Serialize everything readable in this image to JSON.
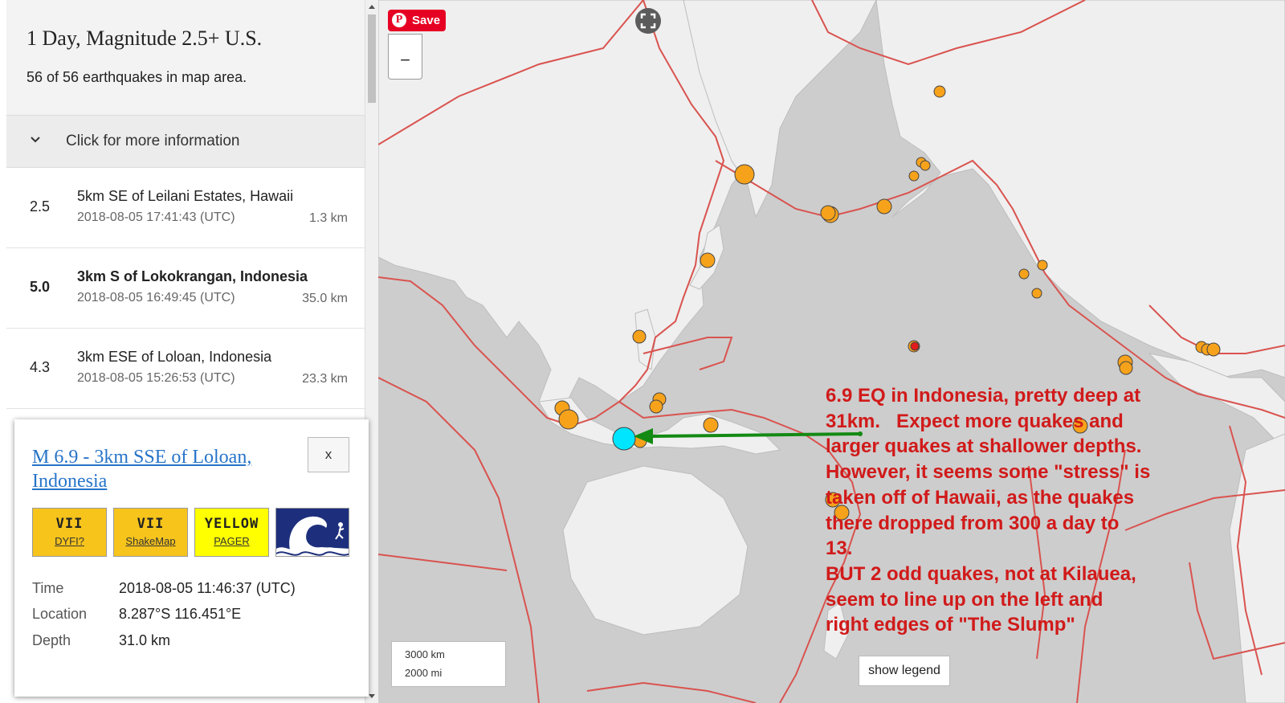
{
  "sidebar": {
    "title": "1 Day, Magnitude 2.5+ U.S.",
    "count_text": "56 of 56 earthquakes in map area.",
    "more_info_label": "Click for more information",
    "earthquakes": [
      {
        "mag": "2.5",
        "place": "5km SE of Leilani Estates, Hawaii",
        "time": "2018-08-05 17:41:43 (UTC)",
        "depth": "1.3 km"
      },
      {
        "mag": "5.0",
        "place": "3km S of Lokokrangan, Indonesia",
        "time": "2018-08-05 16:49:45 (UTC)",
        "depth": "35.0 km"
      },
      {
        "mag": "4.3",
        "place": "3km ESE of Loloan, Indonesia",
        "time": "2018-08-05 15:26:53 (UTC)",
        "depth": "23.3 km"
      }
    ]
  },
  "popup": {
    "title": "M 6.9 - 3km SSE of Loloan, Indonesia",
    "close_label": "x",
    "badges": {
      "dyfi": {
        "value": "VII",
        "label": "DYFI?",
        "color": "#f7c41c"
      },
      "shakemap": {
        "value": "VII",
        "label": "ShakeMap",
        "color": "#f7c41c"
      },
      "pager": {
        "value": "YELLOW",
        "label": "PAGER",
        "color": "#ffff00"
      },
      "tsunami": {
        "icon": "tsunami-wave-icon"
      }
    },
    "details": {
      "time_label": "Time",
      "time_value": "2018-08-05 11:46:37 (UTC)",
      "location_label": "Location",
      "location_value": "8.287°S 116.451°E",
      "depth_label": "Depth",
      "depth_value": "31.0 km"
    }
  },
  "map": {
    "pinterest_label": "Save",
    "zoom_out_label": "−",
    "scale_km": "3000 km",
    "scale_mi": "2000 mi",
    "legend_button": "show legend",
    "annotation": "6.9 EQ in Indonesia, pretty deep at\n31km.   Expect more quakes and\nlarger quakes at shallower depths.\nHowever, it seems some \"stress\" is\ntaken off of Hawaii, as the quakes\nthere dropped from 300 a day to\n13.\nBUT 2 odd quakes, not at Kilauea,\nseem to line up on the left and\nright edges of \"The Slump\"",
    "colors": {
      "land": "#efefef",
      "ocean": "#cdcdcd",
      "plate_boundary": "#d9534f",
      "quake_day": "#f7a21b",
      "quake_hour": "#e21b1b",
      "selected": "#00e5ff",
      "arrow": "#138a13",
      "annotation": "#d11a1a"
    }
  }
}
